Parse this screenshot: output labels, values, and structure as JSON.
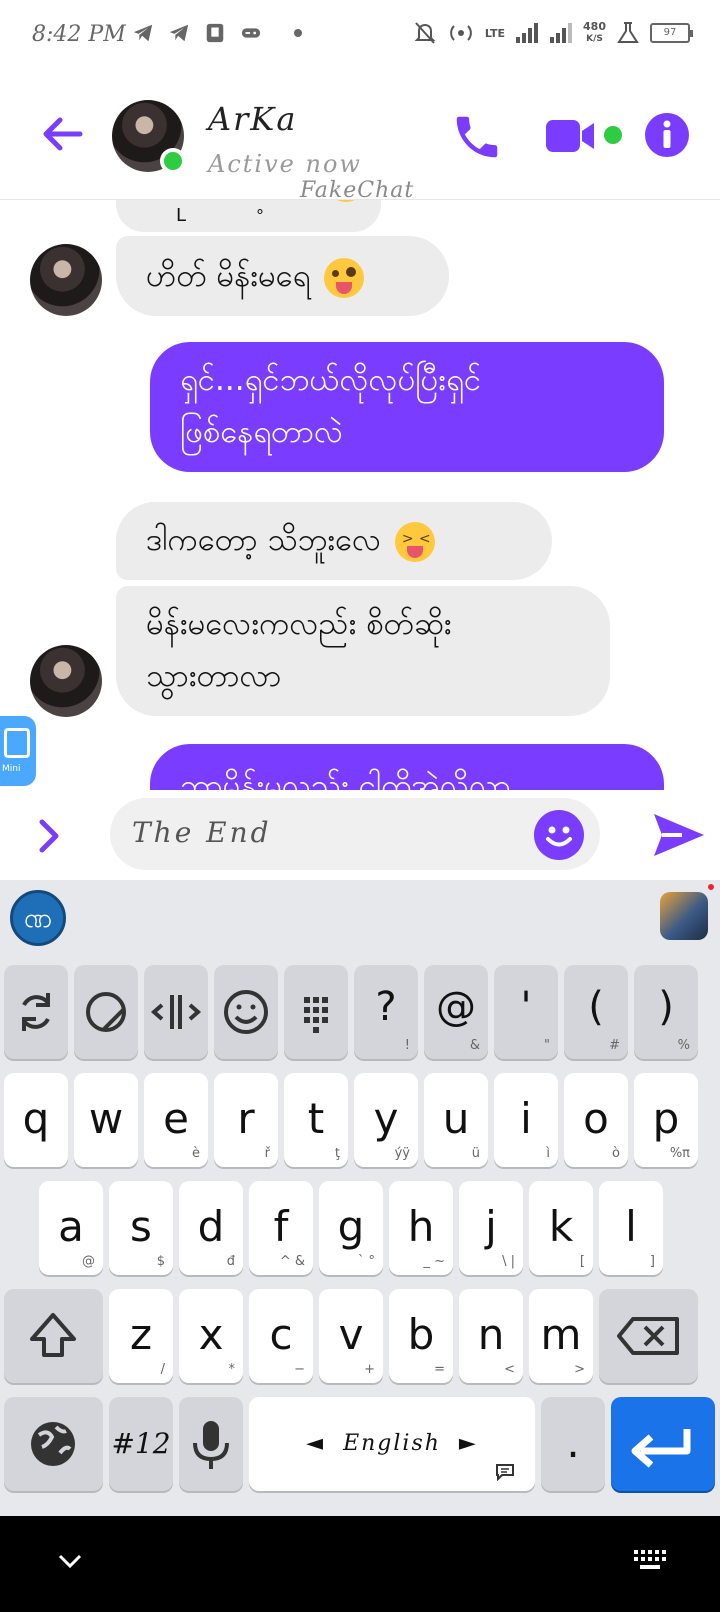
{
  "status": {
    "time": "8:42 PM",
    "network_speed": "480",
    "network_unit": "K/S",
    "lte_label": "LTE",
    "battery": "97"
  },
  "header": {
    "contact_name": "ArKa",
    "status": "Active now",
    "watermark": "FakeChat"
  },
  "messages": [
    {
      "side": "in",
      "text": "ဟိတ် မိန်းမရေ"
    },
    {
      "side": "out",
      "line1": "ရှင်...ရှင်ဘယ်လိုလုပ်ပြီးရှင်",
      "line2": "ဖြစ်နေရတာလဲ"
    },
    {
      "side": "in",
      "text": "ဒါကတော့ သိဘူးလေ"
    },
    {
      "side": "in",
      "line1": "မိန်းမလေးကလည်း စိတ်ဆိုး",
      "line2": "သွားတာလာ"
    },
    {
      "side": "out",
      "text": "ဘာမိန်းမလည်း ငါတိအဲလိုလာ"
    }
  ],
  "compose": {
    "text": "The End"
  },
  "keyboard": {
    "row_symbols": [
      {
        "main": "?",
        "sub": "!"
      },
      {
        "main": "@",
        "sub": "&"
      },
      {
        "main": "'",
        "sub": "\""
      },
      {
        "main": "(",
        "sub": "#"
      },
      {
        "main": ")",
        "sub": "%"
      }
    ],
    "row1": [
      {
        "main": "q",
        "sub": ""
      },
      {
        "main": "w",
        "sub": ""
      },
      {
        "main": "e",
        "sub": "è"
      },
      {
        "main": "r",
        "sub": "ř"
      },
      {
        "main": "t",
        "sub": "ţ"
      },
      {
        "main": "y",
        "sub": "ýÿ"
      },
      {
        "main": "u",
        "sub": "ü"
      },
      {
        "main": "i",
        "sub": "ì"
      },
      {
        "main": "o",
        "sub": "ò"
      },
      {
        "main": "p",
        "sub": "%π"
      }
    ],
    "row2": [
      {
        "main": "a",
        "sub": "@"
      },
      {
        "main": "s",
        "sub": "$"
      },
      {
        "main": "d",
        "sub": "đ"
      },
      {
        "main": "f",
        "sub": "^ &"
      },
      {
        "main": "g",
        "sub": "` °"
      },
      {
        "main": "h",
        "sub": "_ ~"
      },
      {
        "main": "j",
        "sub": "\\ |"
      },
      {
        "main": "k",
        "sub": "["
      },
      {
        "main": "l",
        "sub": "]"
      }
    ],
    "row3": [
      {
        "main": "z",
        "sub": "/"
      },
      {
        "main": "x",
        "sub": "*"
      },
      {
        "main": "c",
        "sub": "−"
      },
      {
        "main": "v",
        "sub": "+"
      },
      {
        "main": "b",
        "sub": "="
      },
      {
        "main": "n",
        "sub": "<"
      },
      {
        "main": "m",
        "sub": ">"
      }
    ],
    "numbers_key": "#12",
    "space_label": "English",
    "period": "."
  },
  "colors": {
    "accent": "#7a3cff",
    "online": "#2ecc40",
    "enter_key": "#1a73e8"
  }
}
